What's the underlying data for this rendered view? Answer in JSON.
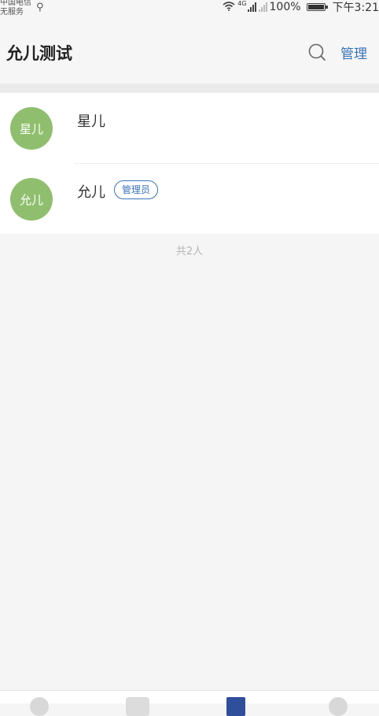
{
  "status_bar": {
    "carrier_line1": "中国电信",
    "carrier_line2": "无服务",
    "network": "4G",
    "battery": "100%",
    "time": "下午3:21"
  },
  "header": {
    "title": "允儿测试",
    "manage_label": "管理"
  },
  "members": [
    {
      "avatar_text": "星儿",
      "name": "星儿",
      "badge": ""
    },
    {
      "avatar_text": "允儿",
      "name": "允儿",
      "badge": "管理员"
    }
  ],
  "member_count": "共2人",
  "colors": {
    "accent": "#3a73b8",
    "avatar": "#8fbf6e",
    "background": "#f5f5f5"
  }
}
